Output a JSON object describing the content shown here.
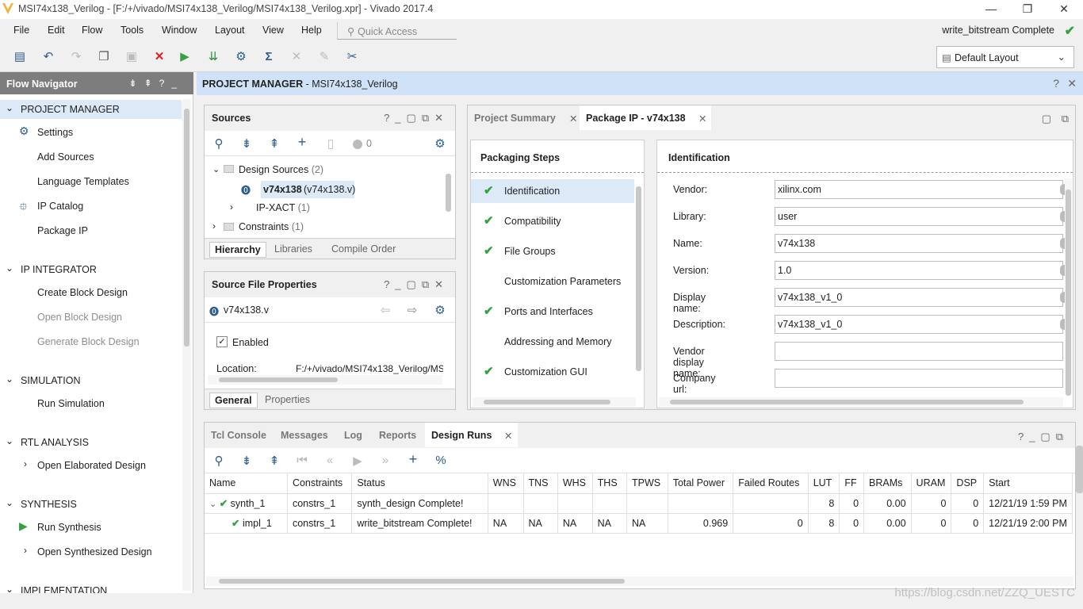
{
  "window": {
    "title": "MSI74x138_Verilog - [F:/+/vivado/MSI74x138_Verilog/MSI74x138_Verilog.xpr] - Vivado 2017.4"
  },
  "menu": [
    "File",
    "Edit",
    "Flow",
    "Tools",
    "Window",
    "Layout",
    "View",
    "Help"
  ],
  "quick_access": {
    "placeholder": "Quick Access"
  },
  "status": "write_bitstream Complete",
  "layout_select": "Default Layout",
  "flow_nav": {
    "title": "Flow Navigator",
    "sections": [
      {
        "label": "PROJECT MANAGER",
        "items": [
          "Settings",
          "Add Sources",
          "Language Templates",
          "IP Catalog",
          "Package IP"
        ]
      },
      {
        "label": "IP INTEGRATOR",
        "items": [
          "Create Block Design",
          "Open Block Design",
          "Generate Block Design"
        ]
      },
      {
        "label": "SIMULATION",
        "items": [
          "Run Simulation"
        ]
      },
      {
        "label": "RTL ANALYSIS",
        "items": [
          "Open Elaborated Design"
        ]
      },
      {
        "label": "SYNTHESIS",
        "items": [
          "Run Synthesis",
          "Open Synthesized Design"
        ]
      },
      {
        "label": "IMPLEMENTATION",
        "items": []
      }
    ]
  },
  "pm_banner": {
    "title": "PROJECT MANAGER",
    "project": " - MSI74x138_Verilog"
  },
  "sources": {
    "title": "Sources",
    "count": "0",
    "tree": {
      "design_sources": "Design Sources",
      "design_sources_count": "(2)",
      "top": "v74x138",
      "top_file": "(v74x138.v)",
      "ipxact": "IP-XACT",
      "ipxact_count": "(1)",
      "constraints": "Constraints",
      "constraints_count": "(1)"
    },
    "tabs": [
      "Hierarchy",
      "Libraries",
      "Compile Order"
    ]
  },
  "props": {
    "title": "Source File Properties",
    "file": "v74x138.v",
    "enabled_label": "Enabled",
    "location_label": "Location:",
    "location_value": "F:/+/vivado/MSI74x138_Verilog/MS",
    "tabs": [
      "General",
      "Properties"
    ]
  },
  "package_ip": {
    "tabs": [
      "Project Summary",
      "Package IP - v74x138"
    ],
    "steps_title": "Packaging Steps",
    "steps": [
      {
        "label": "Identification",
        "done": true
      },
      {
        "label": "Compatibility",
        "done": true
      },
      {
        "label": "File Groups",
        "done": true
      },
      {
        "label": "Customization Parameters",
        "done": false
      },
      {
        "label": "Ports and Interfaces",
        "done": true
      },
      {
        "label": "Addressing and Memory",
        "done": false
      },
      {
        "label": "Customization GUI",
        "done": true
      }
    ],
    "ident_title": "Identification",
    "fields": [
      {
        "label": "Vendor:",
        "value": "xilinx.com"
      },
      {
        "label": "Library:",
        "value": "user"
      },
      {
        "label": "Name:",
        "value": "v74x138"
      },
      {
        "label": "Version:",
        "value": "1.0"
      },
      {
        "label": "Display name:",
        "value": "v74x138_v1_0"
      },
      {
        "label": "Description:",
        "value": "v74x138_v1_0"
      },
      {
        "label": "Vendor display name:",
        "value": ""
      },
      {
        "label": "Company url:",
        "value": ""
      }
    ]
  },
  "bottom": {
    "tabs": [
      "Tcl Console",
      "Messages",
      "Log",
      "Reports",
      "Design Runs"
    ],
    "columns": [
      "Name",
      "Constraints",
      "Status",
      "WNS",
      "TNS",
      "WHS",
      "THS",
      "TPWS",
      "Total Power",
      "Failed Routes",
      "LUT",
      "FF",
      "BRAMs",
      "URAM",
      "DSP",
      "Start"
    ],
    "rows": [
      [
        "synth_1",
        "constrs_1",
        "synth_design Complete!",
        "",
        "",
        "",
        "",
        "",
        "",
        "",
        "8",
        "0",
        "0.00",
        "0",
        "0",
        "12/21/19 1:59 PM"
      ],
      [
        "impl_1",
        "constrs_1",
        "write_bitstream Complete!",
        "NA",
        "NA",
        "NA",
        "NA",
        "NA",
        "0.969",
        "0",
        "8",
        "0",
        "0.00",
        "0",
        "0",
        "12/21/19 2:00 PM"
      ]
    ]
  },
  "watermark": "https://blog.csdn.net/ZZQ_UESTC",
  "colors": {
    "accent": "#2b5d8d",
    "check": "#36a140",
    "banner": "#cfe2f7",
    "nav_header": "#7d7d7d"
  }
}
